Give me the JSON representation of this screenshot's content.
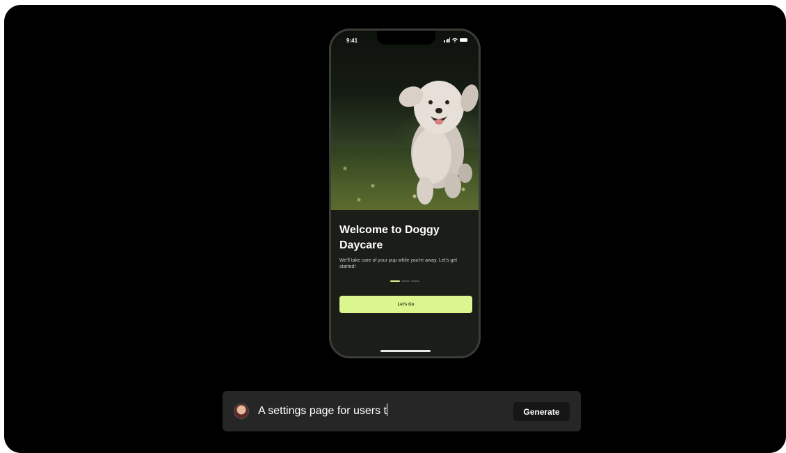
{
  "phone": {
    "status": {
      "time": "9:41"
    },
    "onboarding": {
      "title": "Welcome to Doggy Daycare",
      "subtitle": "We'll take care of your pup while you're away. Let's get started!",
      "cta_label": "Let's Go",
      "page_indicator": {
        "total": 3,
        "active": 1
      }
    }
  },
  "prompt_bar": {
    "input_value": "A settings page for users t",
    "generate_label": "Generate"
  },
  "colors": {
    "background": "#000000",
    "accent": "#dbf58f",
    "phone_surface": "#1b1e18",
    "prompt_surface": "#262626"
  },
  "icons": [
    "signal-icon",
    "wifi-icon",
    "battery-icon",
    "avatar"
  ]
}
